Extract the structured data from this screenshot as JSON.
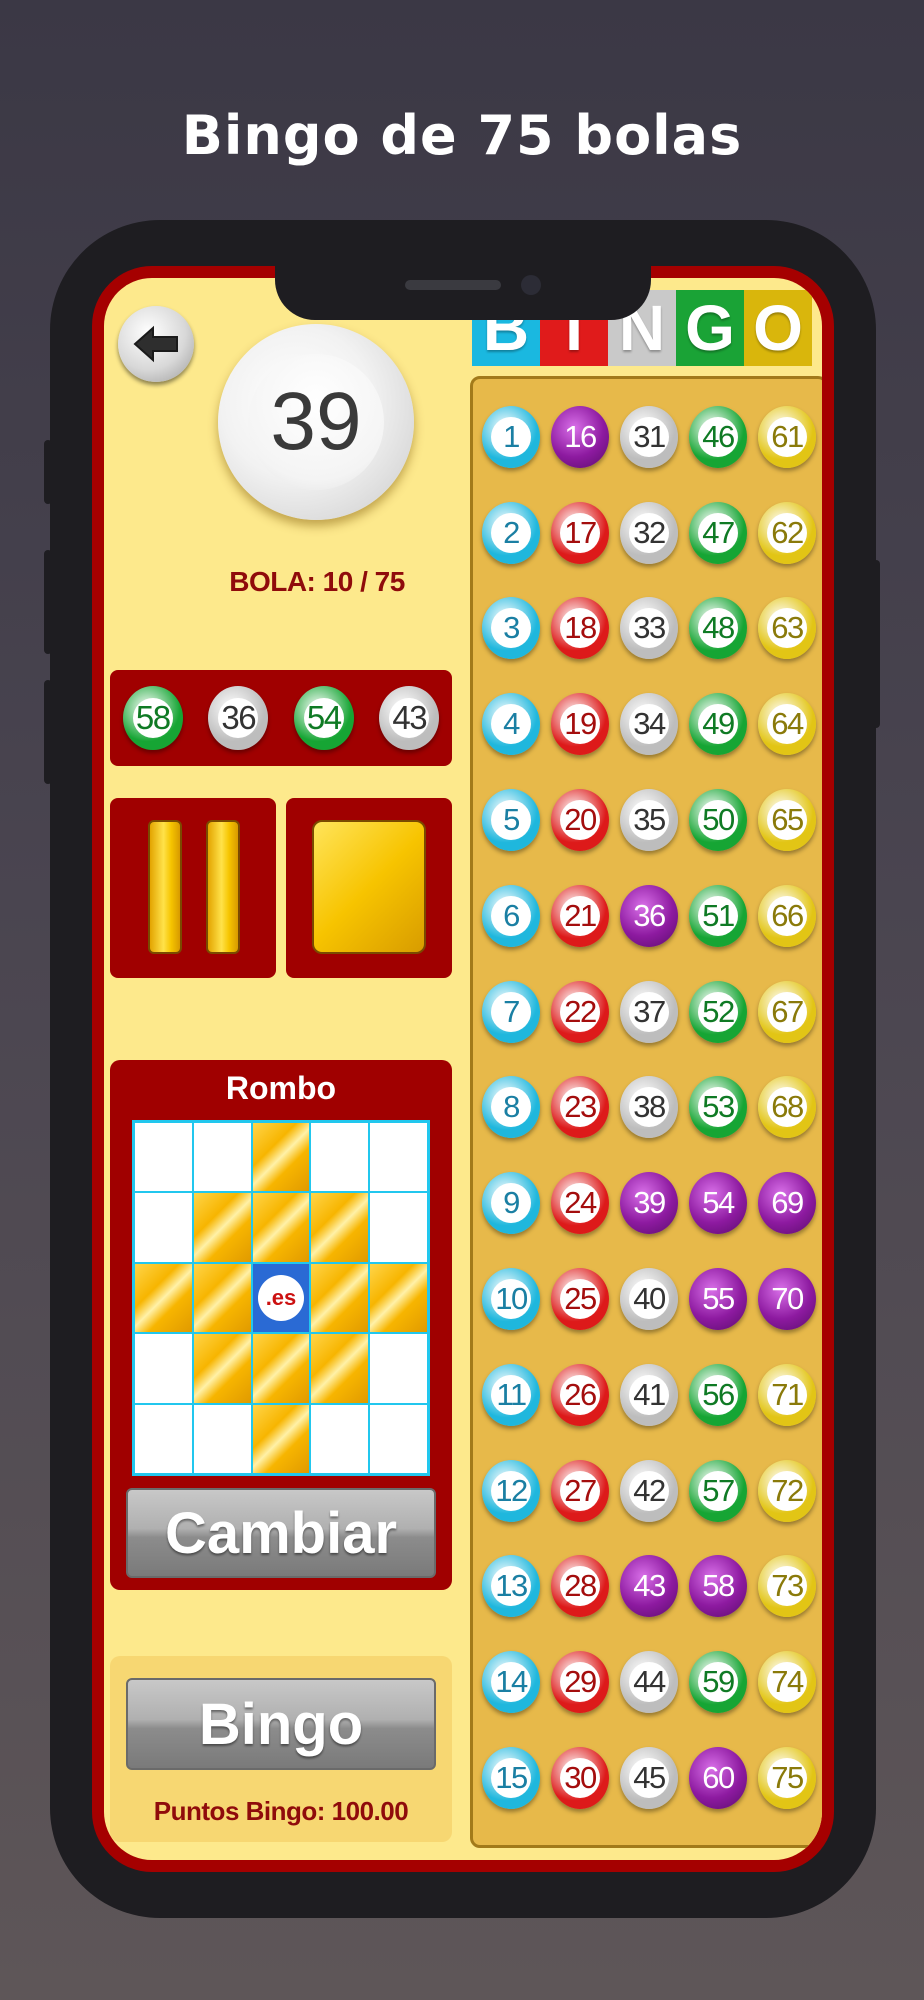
{
  "headline": "Bingo de 75 bolas",
  "header_letters": [
    {
      "letter": "B",
      "color": "#1ab8e0"
    },
    {
      "letter": "I",
      "color": "#e01b1b"
    },
    {
      "letter": "N",
      "color": "#c9c9c9"
    },
    {
      "letter": "G",
      "color": "#1aa336"
    },
    {
      "letter": "O",
      "color": "#d9b60c"
    }
  ],
  "current_ball": {
    "number": "39"
  },
  "ball_counter": "BOLA: 10 / 75",
  "recent_balls": [
    {
      "number": "58",
      "column": "G"
    },
    {
      "number": "36",
      "column": "N"
    },
    {
      "number": "54",
      "column": "G"
    },
    {
      "number": "43",
      "column": "N"
    }
  ],
  "controls": {
    "pause_icon": "pause-icon",
    "stop_icon": "stop-icon",
    "back_icon": "arrow-left-icon"
  },
  "pattern": {
    "title": "Rombo",
    "center_label": ".es",
    "cells": [
      [
        0,
        0,
        1,
        0,
        0
      ],
      [
        0,
        1,
        1,
        1,
        0
      ],
      [
        1,
        1,
        2,
        1,
        1
      ],
      [
        0,
        1,
        1,
        1,
        0
      ],
      [
        0,
        0,
        1,
        0,
        0
      ]
    ]
  },
  "buttons": {
    "change": "Cambiar",
    "bingo": "Bingo"
  },
  "points_label": "Puntos Bingo: 100.00",
  "column_colors": {
    "B": "#1fb7dd",
    "I": "#dd1a1a",
    "N": "#bdbdbd",
    "G": "#16a534",
    "O": "#e2c515",
    "called": "#8d1aa0"
  },
  "column_text_colors": {
    "B": "#1a7fa3",
    "I": "#a40d0d",
    "N": "#333333",
    "G": "#0f7a24",
    "O": "#8a7a0a"
  },
  "called_numbers": [
    16,
    36,
    39,
    54,
    69,
    55,
    70,
    43,
    58,
    60
  ],
  "board_columns": {
    "B": [
      "1",
      "2",
      "3",
      "4",
      "5",
      "6",
      "7",
      "8",
      "9",
      "10",
      "11",
      "12",
      "13",
      "14",
      "15"
    ],
    "I": [
      "16",
      "17",
      "18",
      "19",
      "20",
      "21",
      "22",
      "23",
      "24",
      "25",
      "26",
      "27",
      "28",
      "29",
      "30"
    ],
    "N": [
      "31",
      "32",
      "33",
      "34",
      "35",
      "36",
      "37",
      "38",
      "39",
      "40",
      "41",
      "42",
      "43",
      "44",
      "45"
    ],
    "G": [
      "46",
      "47",
      "48",
      "49",
      "50",
      "51",
      "52",
      "53",
      "54",
      "55",
      "56",
      "57",
      "58",
      "59",
      "60"
    ],
    "O": [
      "61",
      "62",
      "63",
      "64",
      "65",
      "66",
      "67",
      "68",
      "69",
      "70",
      "71",
      "72",
      "73",
      "74",
      "75"
    ]
  }
}
